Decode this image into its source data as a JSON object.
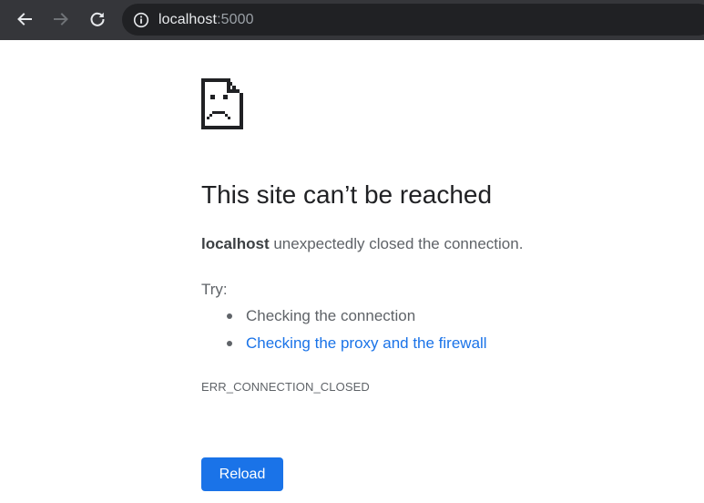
{
  "browser": {
    "address_bar": {
      "host": "localhost",
      "port": ":5000"
    },
    "icons": {
      "back": "arrow-left-icon",
      "forward": "arrow-right-icon",
      "reload": "reload-icon",
      "site_info": "info-icon"
    },
    "colors": {
      "toolbar": "#35363a",
      "omnibox": "#202124"
    }
  },
  "error_page": {
    "icon": "sad-document-icon",
    "title": "This site can’t be reached",
    "message_host": "localhost",
    "message_rest": " unexpectedly closed the connection.",
    "try_label": "Try:",
    "suggestions": [
      {
        "text": "Checking the connection",
        "is_link": false
      },
      {
        "text": "Checking the proxy and the firewall",
        "is_link": true
      }
    ],
    "error_code": "ERR_CONNECTION_CLOSED",
    "reload_label": "Reload",
    "colors": {
      "link": "#1a73e8",
      "button": "#1a73e8",
      "title": "#202124",
      "body_text": "#5f6368"
    }
  }
}
